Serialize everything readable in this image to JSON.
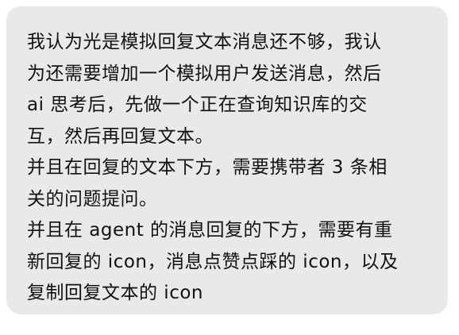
{
  "message": {
    "lines": [
      "我认为光是模拟回复文本消息还不够，我认",
      "为还需要增加一个模拟用户发送消息，然后",
      "ai 思考后，先做一个正在查询知识库的交",
      "互，然后再回复文本。",
      "并且在回复的文本下方，需要携带者 3 条相",
      "关的问题提问。",
      "并且在 agent 的消息回复的下方，需要有重",
      "新回复的 icon，消息点赞点踩的 icon，以及",
      "复制回复文本的 icon"
    ]
  }
}
